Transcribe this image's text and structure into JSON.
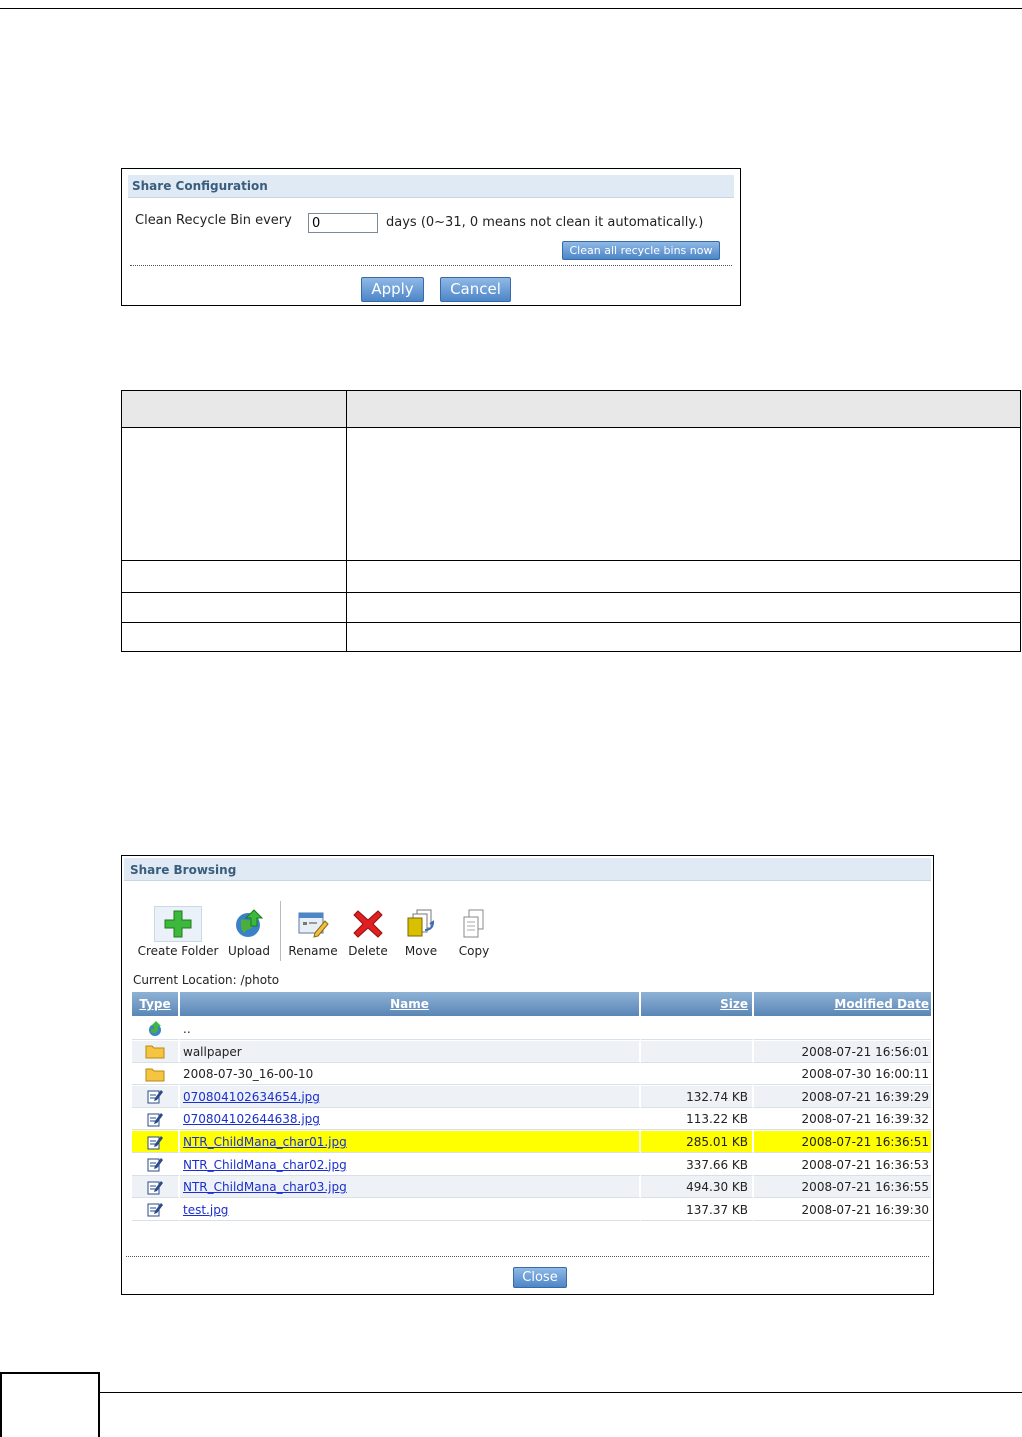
{
  "share_config": {
    "title": "Share Configuration",
    "recycle_label": "Clean Recycle Bin every",
    "recycle_value": "0",
    "recycle_hint": "days (0~31, 0 means not clean it automatically.)",
    "clean_button": "Clean all recycle bins now",
    "apply_button": "Apply",
    "cancel_button": "Cancel"
  },
  "share_browsing": {
    "title": "Share Browsing",
    "toolbar": {
      "create_folder": "Create Folder",
      "upload": "Upload",
      "rename": "Rename",
      "delete": "Delete",
      "move": "Move",
      "copy": "Copy"
    },
    "current_location": "Current Location: /photo",
    "columns": {
      "type": "Type",
      "name": "Name",
      "size": "Size",
      "modified": "Modified Date"
    },
    "rows": [
      {
        "icon": "parent-folder-icon",
        "name": "..",
        "size": "",
        "date": ""
      },
      {
        "icon": "folder-icon",
        "name": "wallpaper",
        "size": "",
        "date": "2008-07-21 16:56:01"
      },
      {
        "icon": "folder-icon",
        "name": "2008-07-30_16-00-10",
        "size": "",
        "date": "2008-07-30 16:00:11"
      },
      {
        "icon": "file-icon",
        "name": "070804102634654.jpg",
        "size": "132.74 KB",
        "date": "2008-07-21 16:39:29"
      },
      {
        "icon": "file-icon",
        "name": "070804102644638.jpg",
        "size": "113.22 KB",
        "date": "2008-07-21 16:39:32"
      },
      {
        "icon": "file-icon",
        "name": "NTR_ChildMana_char01.jpg",
        "size": "285.01 KB",
        "date": "2008-07-21 16:36:51"
      },
      {
        "icon": "file-icon",
        "name": "NTR_ChildMana_char02.jpg",
        "size": "337.66 KB",
        "date": "2008-07-21 16:36:53"
      },
      {
        "icon": "file-icon",
        "name": "NTR_ChildMana_char03.jpg",
        "size": "494.30 KB",
        "date": "2008-07-21 16:36:55"
      },
      {
        "icon": "file-icon",
        "name": "test.jpg",
        "size": "137.37 KB",
        "date": "2008-07-21 16:39:30"
      }
    ],
    "close_button": "Close"
  },
  "colors": {
    "header_bg": "#dfeaf4",
    "header_text": "#3b5d7d",
    "button": "#4d86c8",
    "highlight": "#ffff00",
    "link": "#1a2fd1"
  }
}
